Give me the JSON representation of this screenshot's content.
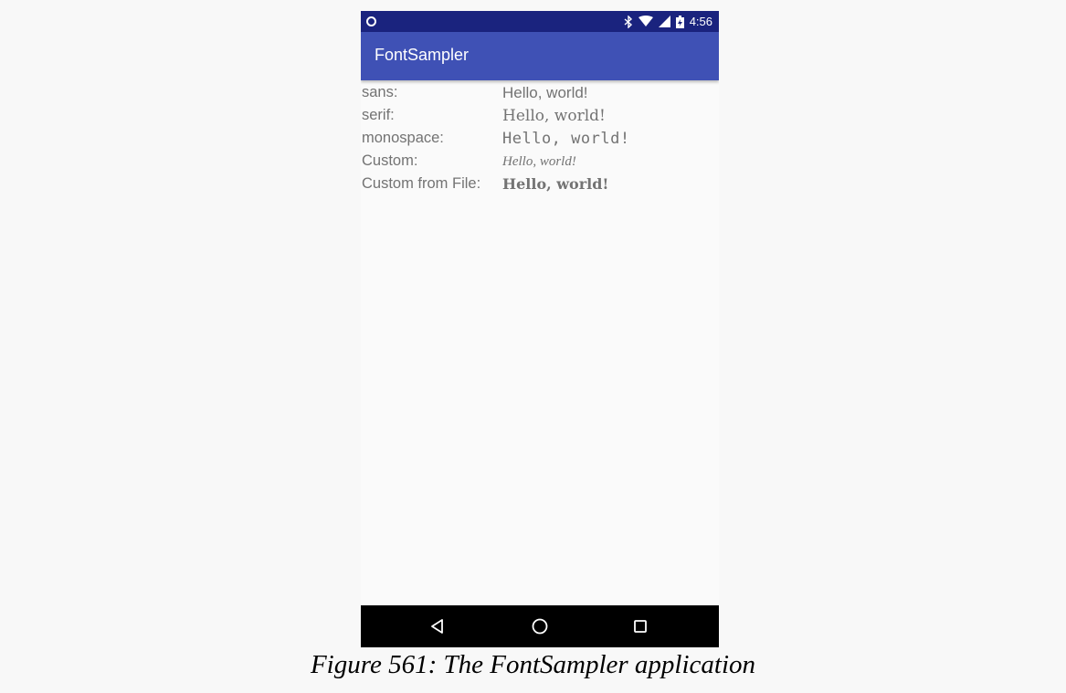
{
  "status_bar": {
    "time": "4:56",
    "icons": [
      "notification-dot-icon",
      "bluetooth-icon",
      "wifi-icon",
      "signal-icon",
      "battery-icon"
    ]
  },
  "app_bar": {
    "title": "FontSampler"
  },
  "rows": [
    {
      "label": "sans:",
      "value": "Hello, world!"
    },
    {
      "label": "serif:",
      "value": "Hello, world!"
    },
    {
      "label": "monospace:",
      "value": "Hello, world!"
    },
    {
      "label": "Custom:",
      "value": "Hello, world!"
    },
    {
      "label": "Custom from File:",
      "value": "Hello, world!"
    }
  ],
  "nav_bar": {
    "icons": [
      "back-icon",
      "home-icon",
      "recents-icon"
    ]
  },
  "caption": "Figure 561: The FontSampler application",
  "colors": {
    "status_bar": "#1a237e",
    "app_bar": "#3f51b5",
    "background": "#fafafa",
    "text": "#737373",
    "nav_bar": "#000000"
  }
}
